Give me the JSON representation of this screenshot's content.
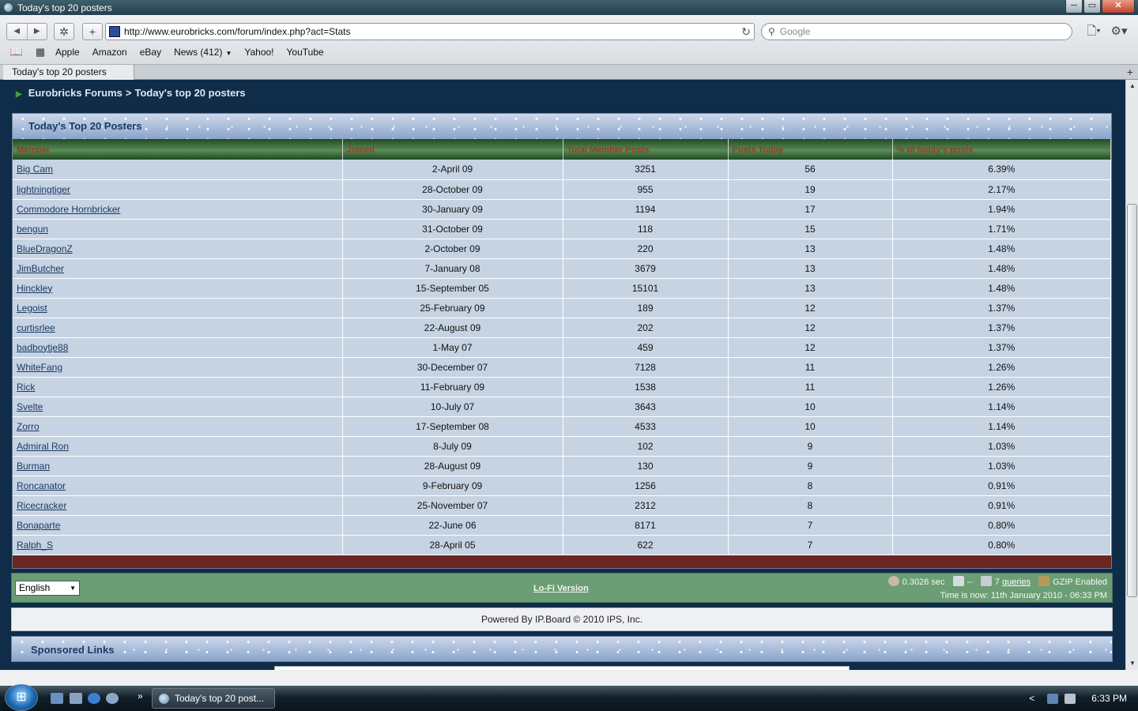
{
  "window": {
    "title": "Today's top 20 posters",
    "min": "─",
    "max": "▭",
    "close": "✕"
  },
  "toolbar": {
    "back": "◀",
    "forward": "▶",
    "bug": "✲",
    "add": "+",
    "url": "http://www.eurobricks.com/forum/index.php?act=Stats",
    "reload": "↻",
    "search_placeholder": "Google",
    "page_menu": "🗋▾",
    "settings_menu": "⚙▾"
  },
  "bookmarks": {
    "book": "📖",
    "grid": "▦",
    "items": [
      "Apple",
      "Amazon",
      "eBay",
      "News (412)",
      "Yahoo!",
      "YouTube"
    ],
    "caret": "▼"
  },
  "tabs": {
    "active": "Today's top 20 posters",
    "new": "+"
  },
  "breadcrumb": {
    "arrow": "▶",
    "root": "Eurobricks Forums",
    "sep": ">",
    "current": "Today's top 20 posters"
  },
  "table": {
    "title": "Today's Top 20 Posters",
    "headers": [
      "Member",
      "Joined",
      "Total Member Posts",
      "Posts Today",
      "% of today's posts"
    ],
    "rows": [
      [
        "Big Cam",
        "2-April 09",
        "3251",
        "56",
        "6.39%"
      ],
      [
        "lightningtiger",
        "28-October 09",
        "955",
        "19",
        "2.17%"
      ],
      [
        "Commodore Hornbricker",
        "30-January 09",
        "1194",
        "17",
        "1.94%"
      ],
      [
        "bengun",
        "31-October 09",
        "118",
        "15",
        "1.71%"
      ],
      [
        "BlueDragonZ",
        "2-October 09",
        "220",
        "13",
        "1.48%"
      ],
      [
        "JimButcher",
        "7-January 08",
        "3679",
        "13",
        "1.48%"
      ],
      [
        "Hinckley",
        "15-September 05",
        "15101",
        "13",
        "1.48%"
      ],
      [
        "Legoist",
        "25-February 09",
        "189",
        "12",
        "1.37%"
      ],
      [
        "curtisrlee",
        "22-August 09",
        "202",
        "12",
        "1.37%"
      ],
      [
        "badboytje88",
        "1-May 07",
        "459",
        "12",
        "1.37%"
      ],
      [
        "WhiteFang",
        "30-December 07",
        "7128",
        "11",
        "1.26%"
      ],
      [
        "Rick",
        "11-February 09",
        "1538",
        "11",
        "1.26%"
      ],
      [
        "Svelte",
        "10-July 07",
        "3643",
        "10",
        "1.14%"
      ],
      [
        "Zorro",
        "17-September 08",
        "4533",
        "10",
        "1.14%"
      ],
      [
        "Admiral Ron",
        "8-July 09",
        "102",
        "9",
        "1.03%"
      ],
      [
        "Burman",
        "28-August 09",
        "130",
        "9",
        "1.03%"
      ],
      [
        "Roncanator",
        "9-February 09",
        "1256",
        "8",
        "0.91%"
      ],
      [
        "Ricecracker",
        "25-November 07",
        "2312",
        "8",
        "0.91%"
      ],
      [
        "Bonaparte",
        "22-June 06",
        "8171",
        "7",
        "0.80%"
      ],
      [
        "Ralph_S",
        "28-April 05",
        "622",
        "7",
        "0.80%"
      ]
    ]
  },
  "footer": {
    "language": "English",
    "lofi": "Lo-Fi Version",
    "exec_time": "0.3026 sec",
    "load": "--",
    "queries_count": "7",
    "queries_link": "queries",
    "gzip": "GZIP Enabled",
    "time_now": "Time is now: 11th January 2010 - 06:33 PM"
  },
  "powered": "Powered By IP.Board © 2010  IPS, Inc.",
  "sponsored": "Sponsored Links",
  "taskbar": {
    "start": "⊞",
    "more": "»",
    "task": "Today's top 20 post...",
    "tray_chev": "<",
    "clock": "6:33 PM"
  },
  "colors": {
    "page_bg": "#0f2c49",
    "header_green": "#3b6b3f",
    "header_text": "#9b3b1e",
    "row_bg": "#c6d3e3",
    "footer_green": "#6b9e74",
    "footer_red": "#6b2523"
  }
}
